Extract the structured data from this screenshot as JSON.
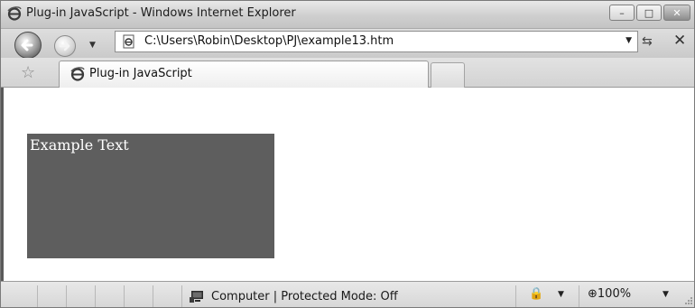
{
  "window": {
    "title": "Plug-in JavaScript - Windows Internet Explorer",
    "controls": {
      "minimize": "–",
      "maximize": "□",
      "close": "✕"
    }
  },
  "navigation": {
    "address": "C:\\Users\\Robin\\Desktop\\PJ\\example13.htm",
    "refresh_icon": "refresh-icon",
    "stop_icon": "stop-icon",
    "stop_glyph": "✕",
    "refresh_glyph": "⇆",
    "dropdown_glyph": "▼"
  },
  "tabs": [
    {
      "label": "Plug-in JavaScript",
      "active": true
    }
  ],
  "favorites": {
    "glyph": "☆"
  },
  "page": {
    "box_text": "Example Text",
    "box_color": "#5e5e5e",
    "text_color": "#ffffff"
  },
  "status": {
    "zone": "Computer | Protected Mode: Off",
    "zoom": "100%",
    "zoom_glyph": "⊕",
    "security_glyph": "🔒",
    "dropdown_glyph": "▼"
  }
}
